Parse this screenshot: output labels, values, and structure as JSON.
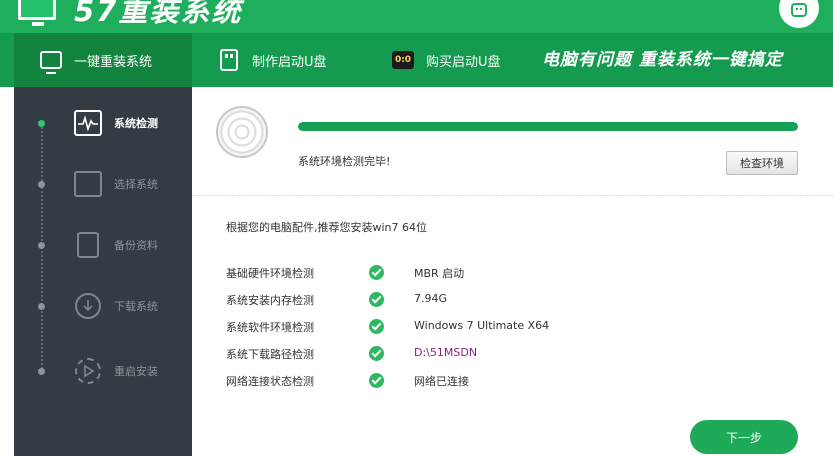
{
  "app": {
    "title": "57重装系统"
  },
  "nav": {
    "tabs": [
      {
        "label": "一键重装系统",
        "icon": "monitor-icon",
        "active": true
      },
      {
        "label": "制作启动U盘",
        "icon": "usb-icon"
      },
      {
        "label": "购买启动U盘",
        "icon": "cat-icon"
      }
    ],
    "cat_icon_text": "0:0",
    "slogan": "电脑有问题 重装系统一键搞定"
  },
  "sidebar": {
    "steps": [
      {
        "label": "系统检测",
        "icon": "pulse-monitor-icon",
        "active": true
      },
      {
        "label": "选择系统",
        "icon": "display-icon"
      },
      {
        "label": "备份资料",
        "icon": "documents-icon"
      },
      {
        "label": "下载系统",
        "icon": "download-icon"
      },
      {
        "label": "重启安装",
        "icon": "restart-icon"
      }
    ]
  },
  "detection": {
    "progress_percent": 100,
    "status_text": "系统环境检测完毕!",
    "check_env_button": "检查环境",
    "recommendation": "根据您的电脑配件,推荐您安装win7 64位",
    "results": [
      {
        "label": "基础硬件环境检测",
        "value": "MBR 启动"
      },
      {
        "label": "系统安装内存检测",
        "value": "7.94G"
      },
      {
        "label": "系统软件环境检测",
        "value": "Windows 7 Ultimate X64"
      },
      {
        "label": "系统下载路径检测",
        "value": "D:\\51MSDN"
      },
      {
        "label": "网络连接状态检测",
        "value": "网络已连接"
      }
    ],
    "next_button": "下一步"
  },
  "colors": {
    "brand_green": "#1fae5b",
    "nav_green": "#159b4f",
    "sidebar_bg": "#333b43",
    "path_purple": "#8c1f7d"
  }
}
